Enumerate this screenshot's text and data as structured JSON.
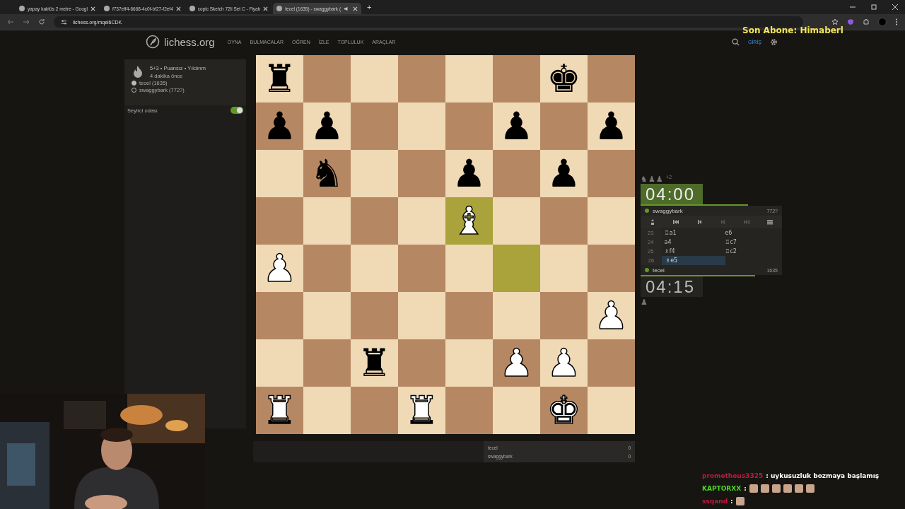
{
  "browser": {
    "tabs": [
      {
        "title": "yapay kaktüs 2 metre - Googl",
        "selected": false,
        "audio": false
      },
      {
        "title": "f737eff4-6668-4c0f-bf27-f2ef4",
        "selected": false,
        "audio": false
      },
      {
        "title": "copic Sketch 72li Set C - Fiyatı",
        "selected": false,
        "audio": false
      },
      {
        "title": "tecel (1635) - swaggybark (",
        "selected": true,
        "audio": true
      }
    ],
    "new_tab": "+",
    "url": "lichess.org/mqel6CDK"
  },
  "header": {
    "logo": "lichess.org",
    "nav": [
      "OYNA",
      "BULMACALAR",
      "ÖĞREN",
      "İZLE",
      "TOPLULUK",
      "ARAÇLAR"
    ],
    "login": "GİRİŞ"
  },
  "game_info": {
    "mode": "5+3 • Puansız • Yıldırım",
    "time": "4 dakika önce",
    "players": [
      {
        "name": "tecel (1635)",
        "white": true
      },
      {
        "name": "swaggybark (772?)",
        "white": false
      }
    ]
  },
  "spectator_room": {
    "label": "Seyirci odası",
    "on": true
  },
  "board": {
    "ranks": [
      {
        "squares": [
          {
            "piece": "♜",
            "white": false,
            "highlighted": false
          },
          {
            "highlighted": false
          },
          {
            "highlighted": false
          },
          {
            "highlighted": false
          },
          {
            "highlighted": false
          },
          {
            "highlighted": false
          },
          {
            "piece": "♚",
            "white": false,
            "highlighted": false
          },
          {
            "highlighted": false
          }
        ]
      },
      {
        "squares": [
          {
            "piece": "♟",
            "white": false,
            "highlighted": false
          },
          {
            "piece": "♟",
            "white": false,
            "highlighted": false
          },
          {
            "highlighted": false
          },
          {
            "highlighted": false
          },
          {
            "highlighted": false
          },
          {
            "piece": "♟",
            "white": false,
            "highlighted": false
          },
          {
            "highlighted": false
          },
          {
            "piece": "♟",
            "white": false,
            "highlighted": false
          }
        ]
      },
      {
        "squares": [
          {
            "highlighted": false
          },
          {
            "piece": "♞",
            "white": false,
            "highlighted": false
          },
          {
            "highlighted": false
          },
          {
            "highlighted": false
          },
          {
            "piece": "♟",
            "white": false,
            "highlighted": false
          },
          {
            "highlighted": false
          },
          {
            "piece": "♟",
            "white": false,
            "highlighted": false
          },
          {
            "highlighted": false
          }
        ]
      },
      {
        "squares": [
          {
            "highlighted": false
          },
          {
            "highlighted": false
          },
          {
            "highlighted": false
          },
          {
            "highlighted": false
          },
          {
            "piece": "♝",
            "white": true,
            "highlighted": true
          },
          {
            "highlighted": false
          },
          {
            "highlighted": false
          },
          {
            "highlighted": false
          }
        ]
      },
      {
        "squares": [
          {
            "piece": "♟",
            "white": true,
            "highlighted": false
          },
          {
            "highlighted": false
          },
          {
            "highlighted": false
          },
          {
            "highlighted": false
          },
          {
            "highlighted": false
          },
          {
            "highlighted": true
          },
          {
            "highlighted": false
          },
          {
            "highlighted": false
          }
        ]
      },
      {
        "squares": [
          {
            "highlighted": false
          },
          {
            "highlighted": false
          },
          {
            "highlighted": false
          },
          {
            "highlighted": false
          },
          {
            "highlighted": false
          },
          {
            "highlighted": false
          },
          {
            "highlighted": false
          },
          {
            "piece": "♟",
            "white": true,
            "highlighted": false
          }
        ]
      },
      {
        "squares": [
          {
            "highlighted": false
          },
          {
            "highlighted": false
          },
          {
            "piece": "♜",
            "white": false,
            "highlighted": false
          },
          {
            "highlighted": false
          },
          {
            "highlighted": false
          },
          {
            "piece": "♟",
            "white": true,
            "highlighted": false
          },
          {
            "piece": "♟",
            "white": true,
            "highlighted": false
          },
          {
            "highlighted": false
          }
        ]
      },
      {
        "squares": [
          {
            "piece": "♜",
            "white": true,
            "highlighted": false
          },
          {
            "highlighted": false
          },
          {
            "highlighted": false
          },
          {
            "piece": "♜",
            "white": true,
            "highlighted": false
          },
          {
            "highlighted": false
          },
          {
            "highlighted": false
          },
          {
            "piece": "♚",
            "white": true,
            "highlighted": false
          },
          {
            "highlighted": false
          }
        ]
      }
    ]
  },
  "score": [
    {
      "name": "tecel",
      "points": "0"
    },
    {
      "name": "swaggybark",
      "points": "0"
    }
  ],
  "top_player": {
    "captured": [
      "♞",
      "♟",
      "♟"
    ],
    "diff": "+2",
    "clock": "04:00",
    "running": true,
    "level": 0.76,
    "name": "swaggybark",
    "rating": "772?",
    "online": true
  },
  "controls": [
    {
      "kind": "flip",
      "disabled": false
    },
    {
      "kind": "first",
      "disabled": false
    },
    {
      "kind": "prev",
      "disabled": false
    },
    {
      "kind": "next",
      "disabled": true
    },
    {
      "kind": "last",
      "disabled": true
    },
    {
      "kind": "menu",
      "disabled": false
    }
  ],
  "moves": [
    {
      "number": "23",
      "plies": [
        {
          "san": "♖a1",
          "selected": false
        },
        {
          "san": "e6",
          "selected": false
        }
      ]
    },
    {
      "number": "24",
      "plies": [
        {
          "san": "a4",
          "selected": false
        },
        {
          "san": "♖c7",
          "selected": false
        }
      ]
    },
    {
      "number": "25",
      "plies": [
        {
          "san": "♗f4",
          "selected": false
        },
        {
          "san": "♖c2",
          "selected": false
        }
      ]
    },
    {
      "number": "26",
      "plies": [
        {
          "san": "♗e5",
          "selected": true
        }
      ]
    }
  ],
  "bottom_player": {
    "name": "tecel",
    "rating": "1635",
    "online": true,
    "level": 0.81,
    "clock": "04:15",
    "running": false,
    "captured": [
      "♟"
    ]
  },
  "overlay": {
    "subscriber": "Son Abone: Himaberl",
    "chat": [
      {
        "user": "prometheus3325",
        "color": "#c0183c",
        "text": ": uykusuzluk bozmaya başlamış"
      },
      {
        "user": "KAPTORXX",
        "color": "#4cd61e",
        "text": ":"
      },
      {
        "user": "ssqand",
        "color": "#c0183c",
        "text": ":"
      }
    ]
  }
}
